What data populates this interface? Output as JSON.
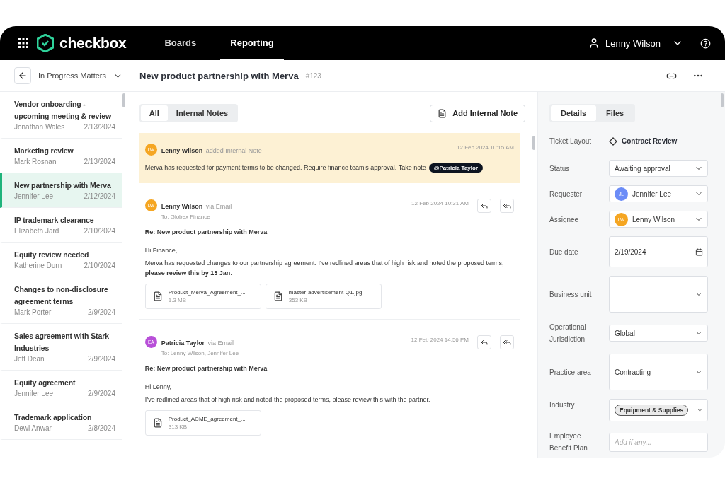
{
  "nav": {
    "brand": "checkbox",
    "items": [
      {
        "label": "Boards",
        "selected": false
      },
      {
        "label": "Reporting",
        "selected": true
      }
    ],
    "user": "Lenny Wilson"
  },
  "list_header": {
    "title": "In Progress Matters"
  },
  "ticket": {
    "title": "New product partnership with Merva",
    "number": "#123"
  },
  "matters": [
    {
      "title": "Vendor onboarding - upcoming meeting & review",
      "person": "Jonathan Wales",
      "date": "2/13/2024",
      "selected": false
    },
    {
      "title": "Marketing review",
      "person": "Mark Rosnan",
      "date": "2/13/2024",
      "selected": false
    },
    {
      "title": "New partnership with Merva",
      "person": "Jennifer Lee",
      "date": "2/12/2024",
      "selected": true
    },
    {
      "title": "IP trademark clearance",
      "person": "Elizabeth Jard",
      "date": "2/10/2024",
      "selected": false
    },
    {
      "title": "Equity review needed",
      "person": "Katherine Durn",
      "date": "2/10/2024",
      "selected": false
    },
    {
      "title": "Changes to non-disclosure agreement terms",
      "person": "Mark Porter",
      "date": "2/9/2024",
      "selected": false
    },
    {
      "title": "Sales agreement with Stark Industries",
      "person": "Jeff Dean",
      "date": "2/9/2024",
      "selected": false
    },
    {
      "title": "Equity agreement",
      "person": "Jennifer Lee",
      "date": "2/9/2024",
      "selected": false
    },
    {
      "title": "Trademark application",
      "person": "Dewi Anwar",
      "date": "2/8/2024",
      "selected": false
    }
  ],
  "thread_tabs": [
    {
      "label": "All",
      "selected": true
    },
    {
      "label": "Internal Notes",
      "selected": false
    }
  ],
  "add_note_button": "Add Internal Note",
  "messages": [
    {
      "kind": "note",
      "initials": "LW",
      "color": "#f5a623",
      "author": "Lenny Wilson",
      "action": "added Internal Note",
      "time": "12 Feb 2024 10:15 AM",
      "body": "Merva has requested for payment terms to be changed. Require finance team’s approval. Take note",
      "mention": "@Patricia Taylor"
    },
    {
      "kind": "email",
      "initials": "LW",
      "color": "#f5a623",
      "author": "Lenny Wilson",
      "action": "via Email",
      "to": "To: Globex Finance",
      "time": "12 Feb 2024 10:31 AM",
      "subject": "Re: New product partnership with Merva",
      "greeting": "Hi Finance,",
      "body": "Merva has requested changes to our partnership agreement. I’ve redlined areas that of high risk and noted the proposed terms, **please review this by 13 Jan**.",
      "attachments": [
        {
          "name": "Product_Merva_Agreement_...",
          "size": "1.3 MB"
        },
        {
          "name": "master-advertisement-Q1.jpg",
          "size": "353 KB"
        }
      ]
    },
    {
      "kind": "email",
      "initials": "EA",
      "color": "#b84fd8",
      "author": "Patricia Taylor",
      "action": "via Email",
      "to": "To: Lenny Wilson, Jennifer Lee",
      "time": "12 Feb 2024 14:56 PM",
      "subject": "Re: New product partnership with Merva",
      "greeting": "Hi Lenny,",
      "body": "I’ve redlined areas that of high risk and noted the proposed terms, please review this with the partner.",
      "attachments": [
        {
          "name": "Product_ACME_agreement_...",
          "size": "313 KB"
        }
      ]
    }
  ],
  "detail_tabs": [
    {
      "label": "Details",
      "selected": true
    },
    {
      "label": "Files",
      "selected": false
    }
  ],
  "fields": [
    {
      "label": "Ticket Layout",
      "kind": "layout",
      "value": "Contract Review"
    },
    {
      "label": "Status",
      "kind": "select",
      "value": "Awaiting approval"
    },
    {
      "label": "Requester",
      "kind": "person",
      "value": "Jennifer Lee",
      "initials": "JL",
      "color": "#6b8cf7"
    },
    {
      "label": "Assignee",
      "kind": "person",
      "value": "Lenny Wilson",
      "initials": "LW",
      "color": "#f5a623"
    },
    {
      "label": "Due date",
      "kind": "date",
      "value": "2/19/2024"
    },
    {
      "label": "Business unit",
      "kind": "multiselect"
    },
    {
      "label": "Operational Jurisdiction",
      "kind": "select",
      "value": "Global"
    },
    {
      "label": "Practice area",
      "kind": "multiselect",
      "value": "Contracting"
    },
    {
      "label": "Industry",
      "kind": "tag",
      "value": "Equipment & Supplies"
    },
    {
      "label": "Employee Benefit Plan",
      "kind": "input",
      "placeholder": "Add if any..."
    }
  ]
}
